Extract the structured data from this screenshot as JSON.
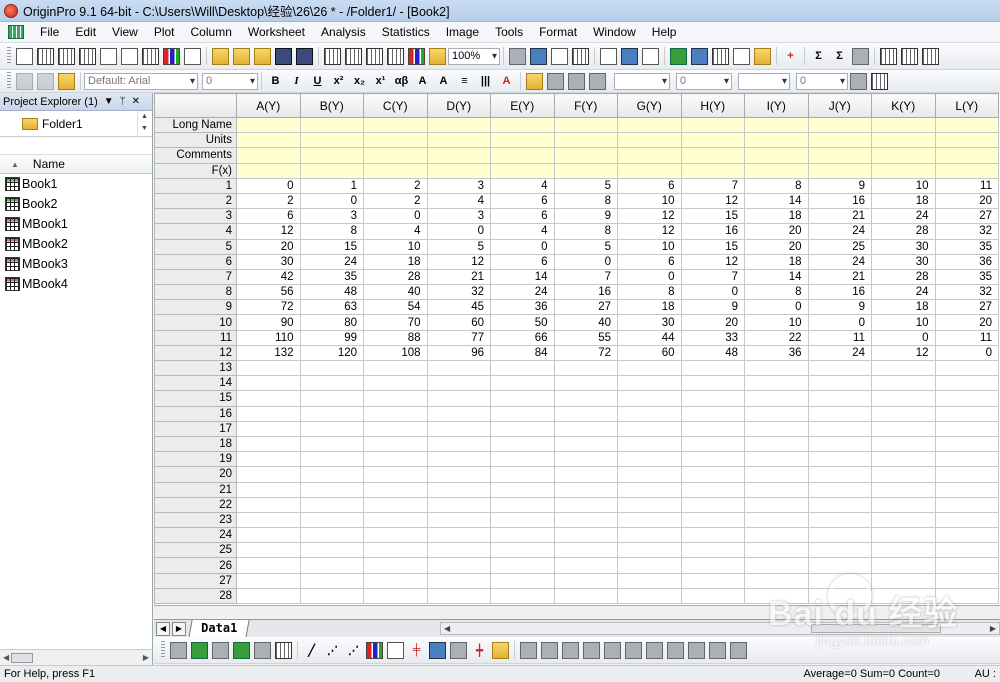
{
  "window": {
    "title": "OriginPro 9.1 64-bit - C:\\Users\\Will\\Desktop\\经验\\26\\26 * - /Folder1/ - [Book2]"
  },
  "menu": [
    "File",
    "Edit",
    "View",
    "Plot",
    "Column",
    "Worksheet",
    "Analysis",
    "Statistics",
    "Image",
    "Tools",
    "Format",
    "Window",
    "Help"
  ],
  "toolbar": {
    "zoom": "100%",
    "font_name": "Default: Arial",
    "font_size": "0",
    "line_width": "0",
    "border_width": "0"
  },
  "explorer": {
    "header": "Project Explorer (1)",
    "pin": "ᛘ",
    "close": "✕",
    "folder": "Folder1",
    "name_header": "Name",
    "items": [
      {
        "name": "Book1",
        "kind": "g"
      },
      {
        "name": "Book2",
        "kind": "g"
      },
      {
        "name": "MBook1",
        "kind": "m"
      },
      {
        "name": "MBook2",
        "kind": "m"
      },
      {
        "name": "MBook3",
        "kind": "m"
      },
      {
        "name": "MBook4",
        "kind": "m"
      }
    ]
  },
  "sheet": {
    "columns": [
      "A(Y)",
      "B(Y)",
      "C(Y)",
      "D(Y)",
      "E(Y)",
      "F(Y)",
      "G(Y)",
      "H(Y)",
      "I(Y)",
      "J(Y)",
      "K(Y)",
      "L(Y)"
    ],
    "meta_rows": [
      "Long Name",
      "Units",
      "Comments",
      "F(x)"
    ],
    "total_rows": 28,
    "rows": [
      [
        0,
        1,
        2,
        3,
        4,
        5,
        6,
        7,
        8,
        9,
        10,
        11
      ],
      [
        2,
        0,
        2,
        4,
        6,
        8,
        10,
        12,
        14,
        16,
        18,
        20
      ],
      [
        6,
        3,
        0,
        3,
        6,
        9,
        12,
        15,
        18,
        21,
        24,
        27
      ],
      [
        12,
        8,
        4,
        0,
        4,
        8,
        12,
        16,
        20,
        24,
        28,
        32
      ],
      [
        20,
        15,
        10,
        5,
        0,
        5,
        10,
        15,
        20,
        25,
        30,
        35
      ],
      [
        30,
        24,
        18,
        12,
        6,
        0,
        6,
        12,
        18,
        24,
        30,
        36
      ],
      [
        42,
        35,
        28,
        21,
        14,
        7,
        0,
        7,
        14,
        21,
        28,
        35
      ],
      [
        56,
        48,
        40,
        32,
        24,
        16,
        8,
        0,
        8,
        16,
        24,
        32
      ],
      [
        72,
        63,
        54,
        45,
        36,
        27,
        18,
        9,
        0,
        9,
        18,
        27
      ],
      [
        90,
        80,
        70,
        60,
        50,
        40,
        30,
        20,
        10,
        0,
        10,
        20
      ],
      [
        110,
        99,
        88,
        77,
        66,
        55,
        44,
        33,
        22,
        11,
        0,
        11
      ],
      [
        132,
        120,
        108,
        96,
        84,
        72,
        60,
        48,
        36,
        24,
        12,
        0
      ]
    ],
    "tab": "Data1"
  },
  "status": {
    "help": "For Help, press F1",
    "stats": "Average=0 Sum=0 Count=0",
    "au": "AU :"
  },
  "watermark": {
    "text": "Bai du 经验",
    "sub": "jingyan.baidu.com"
  }
}
